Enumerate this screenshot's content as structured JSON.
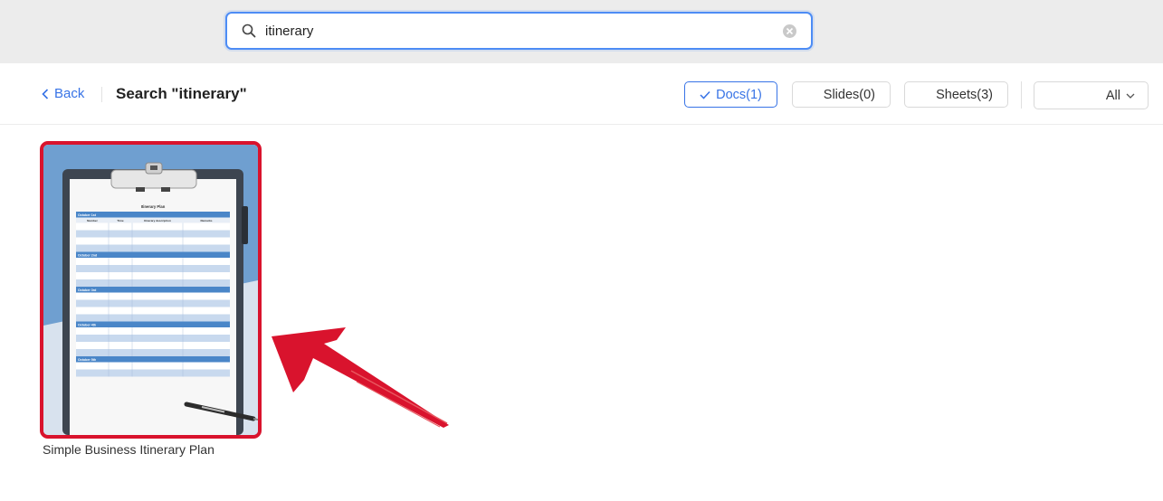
{
  "search": {
    "value": "itinerary",
    "placeholder": ""
  },
  "toolbar": {
    "back_label": "Back",
    "title": "Search \"itinerary\"",
    "filters": {
      "docs": "Docs(1)",
      "slides": "Slides(0)",
      "sheets": "Sheets(3)"
    },
    "scope_dropdown": "All"
  },
  "results": [
    {
      "name": "Simple Business Itinerary Plan",
      "preview": {
        "heading": "Itinerary Plan",
        "columns": [
          "Number",
          "Time",
          "Itinerary description",
          "Remarks"
        ],
        "sections": [
          "October 1st",
          "October 2nd",
          "October 3rd",
          "October 4th",
          "October 5th"
        ]
      }
    }
  ],
  "colors": {
    "accent": "#3773e6",
    "highlight": "#d9132d",
    "table_blue": "#4a86c8"
  }
}
